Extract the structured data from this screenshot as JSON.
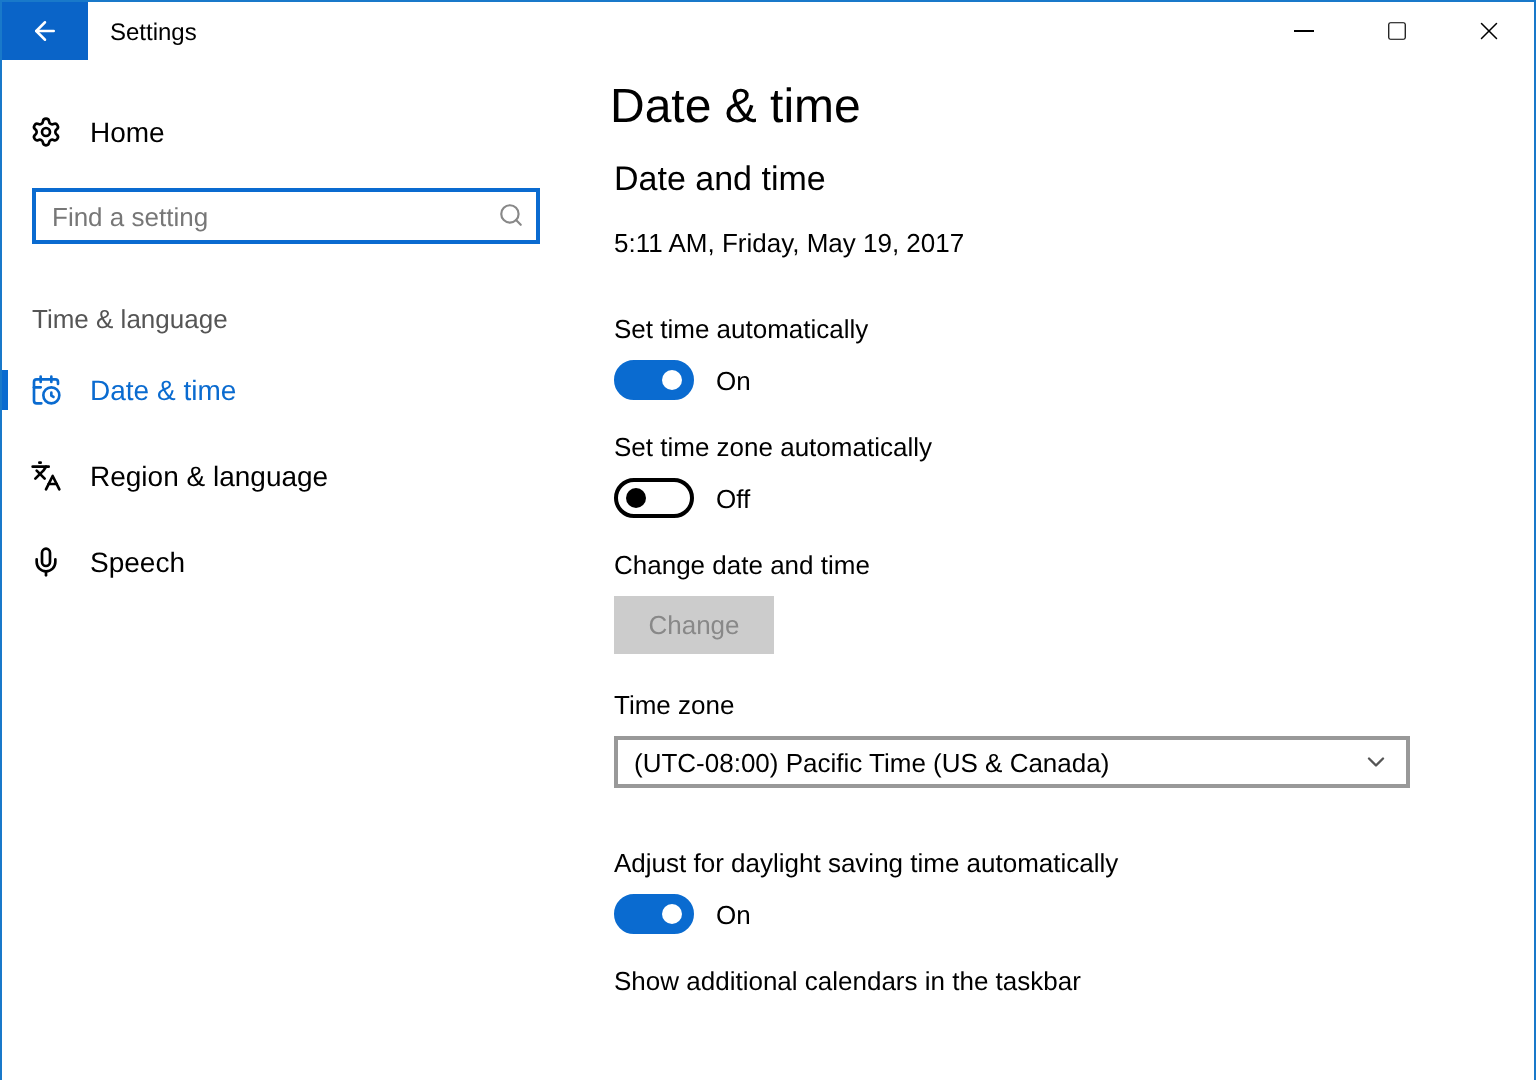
{
  "window": {
    "title": "Settings"
  },
  "sidebar": {
    "home": "Home",
    "search": {
      "placeholder": "Find a setting"
    },
    "section": "Time & language",
    "items": [
      {
        "label": "Date & time",
        "selected": true,
        "kind": "calendar"
      },
      {
        "label": "Region & language",
        "selected": false,
        "kind": "language"
      },
      {
        "label": "Speech",
        "selected": false,
        "kind": "mic"
      }
    ]
  },
  "page": {
    "title": "Date & time",
    "heading": "Date and time",
    "settings": [
      {
        "kind": "text",
        "value": "5:11 AM, Friday, May 19, 2017"
      },
      {
        "kind": "toggle",
        "label": "Set time automatically",
        "on": true,
        "state_text": "On"
      },
      {
        "kind": "toggle",
        "label": "Set time zone automatically",
        "on": false,
        "state_text": "Off"
      },
      {
        "kind": "button",
        "label": "Change date and time",
        "button": "Change",
        "disabled": true
      },
      {
        "kind": "dropdown",
        "label": "Time zone",
        "value": "(UTC-08:00) Pacific Time (US & Canada)"
      },
      {
        "kind": "toggle",
        "label": "Adjust for daylight saving time automatically",
        "on": true,
        "state_text": "On"
      },
      {
        "kind": "label",
        "label": "Show additional calendars in the taskbar"
      }
    ]
  }
}
